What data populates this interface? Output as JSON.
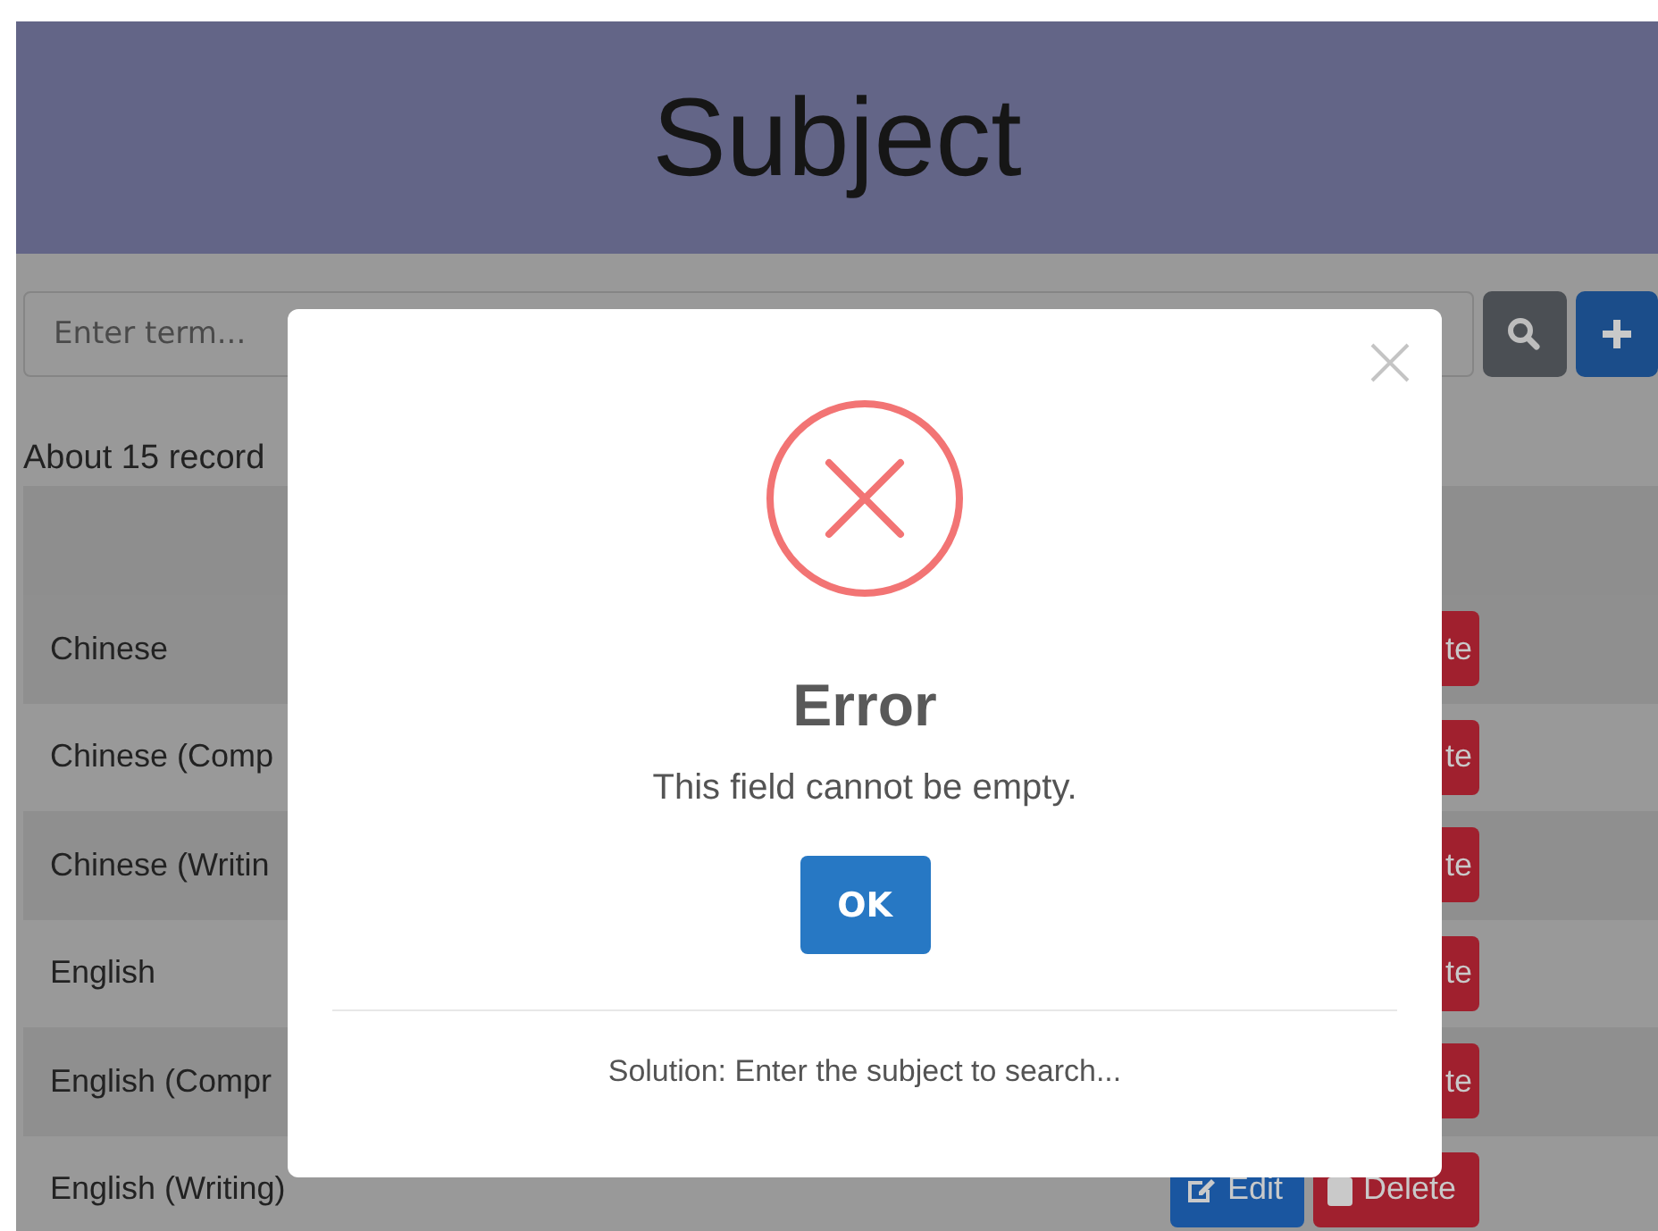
{
  "header": {
    "title": "Subject"
  },
  "search": {
    "placeholder": "Enter term..."
  },
  "record_count": "About 15 record",
  "table": {
    "rows": [
      {
        "name": "Chinese",
        "actions": [
          {
            "kind": "delete",
            "label": "te"
          }
        ]
      },
      {
        "name": "Chinese (Comp",
        "actions": [
          {
            "kind": "delete",
            "label": "te"
          }
        ]
      },
      {
        "name": "Chinese (Writin",
        "actions": [
          {
            "kind": "delete",
            "label": "te"
          }
        ]
      },
      {
        "name": "English",
        "actions": [
          {
            "kind": "delete",
            "label": "te"
          }
        ]
      },
      {
        "name": "English (Compr",
        "actions": [
          {
            "kind": "delete",
            "label": "te"
          }
        ]
      },
      {
        "name": "English (Writing)",
        "actions": [
          {
            "kind": "edit",
            "label": "Edit"
          },
          {
            "kind": "delete",
            "label": "Delete"
          }
        ]
      }
    ]
  },
  "dialog": {
    "title": "Error",
    "message": "This field cannot be empty.",
    "button": "OK",
    "footer": "Solution: Enter the subject to search..."
  }
}
